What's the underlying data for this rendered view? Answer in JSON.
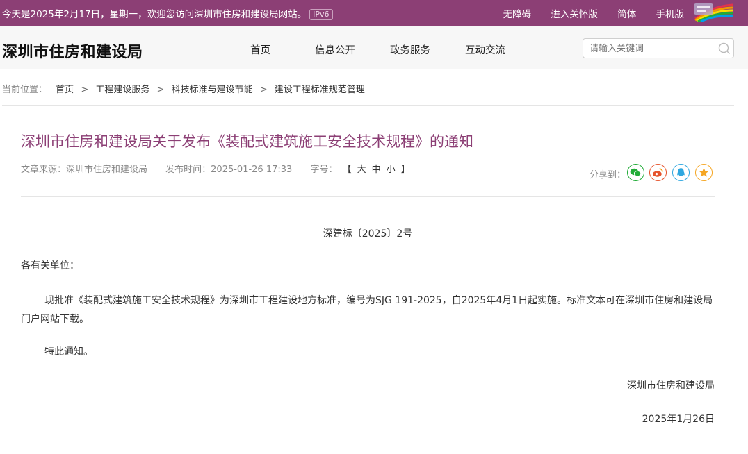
{
  "topbar": {
    "welcome": "今天是2025年2月17日，星期一，欢迎您访问深圳市住房和建设局网站。",
    "ipv6": "IPv6",
    "links": [
      "无障碍",
      "进入关怀版",
      "简体",
      "手机版"
    ],
    "bg_color": "#8c3f75"
  },
  "header": {
    "site_title": "深圳市住房和建设局",
    "nav": [
      "首页",
      "信息公开",
      "政务服务",
      "互动交流"
    ],
    "search_placeholder": "请输入关键词"
  },
  "breadcrumb": {
    "label": "当前位置：",
    "items": [
      "首页",
      "工程建设服务",
      "科技标准与建设节能",
      "建设工程标准规范管理"
    ],
    "separator": ">"
  },
  "article": {
    "title": "深圳市住房和建设局关于发布《装配式建筑施工安全技术规程》的通知",
    "source": "文章来源：深圳市住房和建设局",
    "published": "发布时间：2025-01-26 17:33",
    "font_size_label": "字号：",
    "font_size_open": "【",
    "font_sizes": [
      "大",
      "中",
      "小"
    ],
    "font_size_close": "】",
    "share_label": "分享到：",
    "share_icons": [
      "wechat-icon",
      "weibo-icon",
      "qq-icon",
      "favorite-icon"
    ],
    "doc_number": "深建标〔2025〕2号",
    "salutation": "各有关单位：",
    "body": "现批准《装配式建筑施工安全技术规程》为深圳市工程建设地方标准，编号为SJG 191-2025，自2025年4月1日起实施。标准文本可在深圳市住房和建设局门户网站下载。",
    "closing": "特此通知。",
    "signature": "深圳市住房和建设局",
    "date": "2025年1月26日",
    "title_color": "#8c3f75"
  }
}
